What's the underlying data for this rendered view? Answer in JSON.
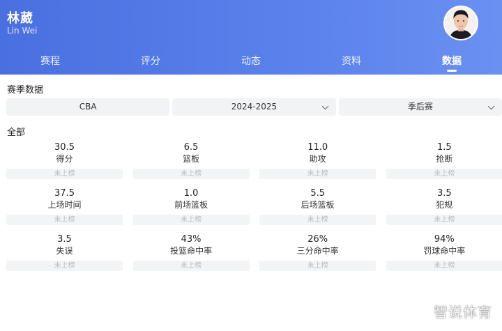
{
  "header": {
    "name": "林葳",
    "name_en": "Lin Wei"
  },
  "tabs": [
    {
      "label": "赛程"
    },
    {
      "label": "评分"
    },
    {
      "label": "动态"
    },
    {
      "label": "资料"
    },
    {
      "label": "数据",
      "active": true
    }
  ],
  "section_title": "赛季数据",
  "filters": {
    "league": "CBA",
    "season": "2024-2025",
    "stage": "季后赛"
  },
  "group_title": "全部",
  "stats": [
    {
      "value": "30.5",
      "label": "得分",
      "rank": "未上榜"
    },
    {
      "value": "6.5",
      "label": "篮板",
      "rank": "未上榜"
    },
    {
      "value": "11.0",
      "label": "助攻",
      "rank": "未上榜"
    },
    {
      "value": "1.5",
      "label": "抢断",
      "rank": "未上榜"
    },
    {
      "value": "37.5",
      "label": "上场时间",
      "rank": "未上榜"
    },
    {
      "value": "1.0",
      "label": "前场篮板",
      "rank": "未上榜"
    },
    {
      "value": "5.5",
      "label": "后场篮板",
      "rank": "未上榜"
    },
    {
      "value": "3.5",
      "label": "犯规",
      "rank": "未上榜"
    },
    {
      "value": "3.5",
      "label": "失误",
      "rank": "未上榜"
    },
    {
      "value": "43%",
      "label": "投篮命中率",
      "rank": "未上榜"
    },
    {
      "value": "26%",
      "label": "三分命中率",
      "rank": "未上榜"
    },
    {
      "value": "94%",
      "label": "罚球命中率",
      "rank": "未上榜"
    }
  ],
  "watermark": "智说体育",
  "colors": {
    "header_start": "#4a6fe0",
    "header_end": "#6a90f2",
    "filter_bg": "#f2f3f5",
    "rank_bg": "#f3f4f6"
  },
  "icons": {
    "avatar": "player-avatar",
    "dropdown": "chevron-down-icon"
  }
}
